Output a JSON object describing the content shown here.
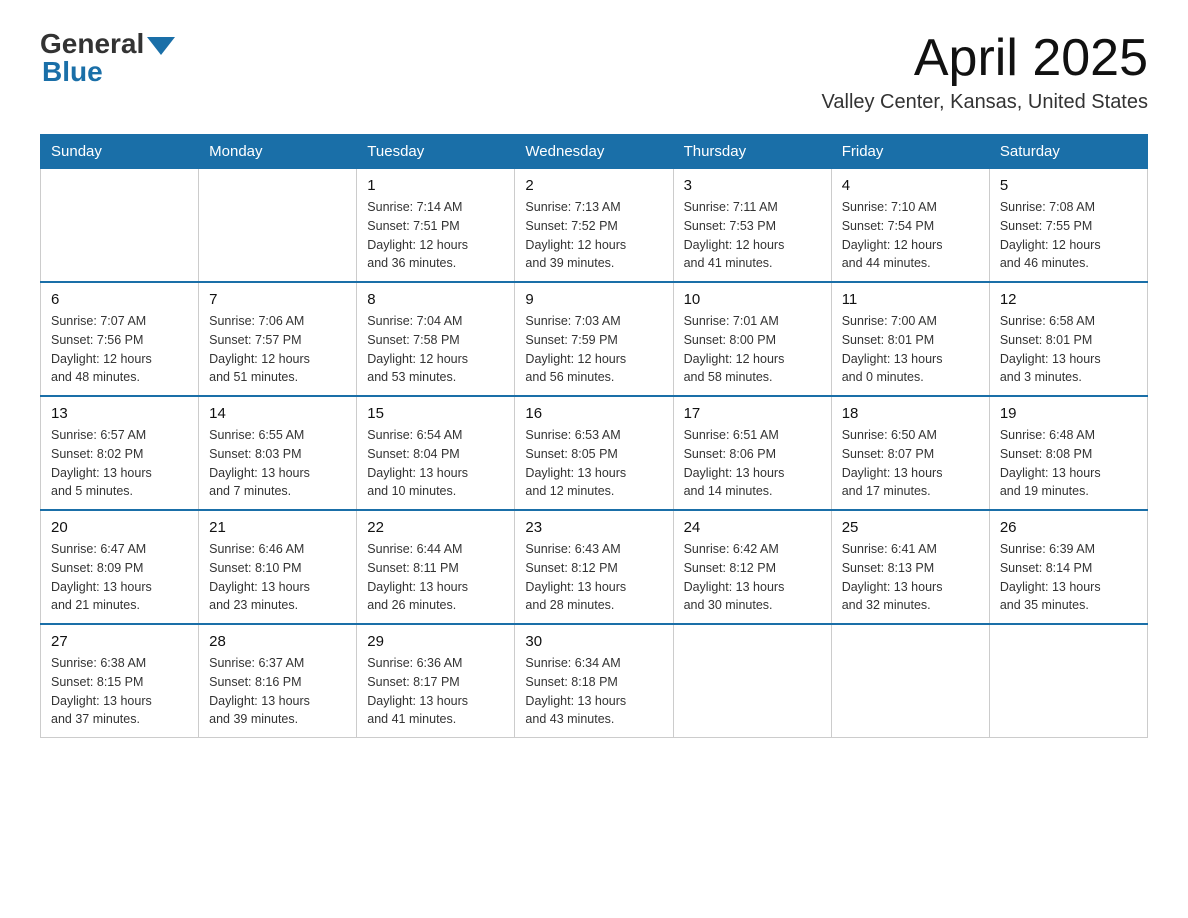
{
  "header": {
    "logo_general": "General",
    "logo_blue": "Blue",
    "title": "April 2025",
    "subtitle": "Valley Center, Kansas, United States"
  },
  "days_of_week": [
    "Sunday",
    "Monday",
    "Tuesday",
    "Wednesday",
    "Thursday",
    "Friday",
    "Saturday"
  ],
  "weeks": [
    [
      {
        "day": "",
        "info": ""
      },
      {
        "day": "",
        "info": ""
      },
      {
        "day": "1",
        "info": "Sunrise: 7:14 AM\nSunset: 7:51 PM\nDaylight: 12 hours\nand 36 minutes."
      },
      {
        "day": "2",
        "info": "Sunrise: 7:13 AM\nSunset: 7:52 PM\nDaylight: 12 hours\nand 39 minutes."
      },
      {
        "day": "3",
        "info": "Sunrise: 7:11 AM\nSunset: 7:53 PM\nDaylight: 12 hours\nand 41 minutes."
      },
      {
        "day": "4",
        "info": "Sunrise: 7:10 AM\nSunset: 7:54 PM\nDaylight: 12 hours\nand 44 minutes."
      },
      {
        "day": "5",
        "info": "Sunrise: 7:08 AM\nSunset: 7:55 PM\nDaylight: 12 hours\nand 46 minutes."
      }
    ],
    [
      {
        "day": "6",
        "info": "Sunrise: 7:07 AM\nSunset: 7:56 PM\nDaylight: 12 hours\nand 48 minutes."
      },
      {
        "day": "7",
        "info": "Sunrise: 7:06 AM\nSunset: 7:57 PM\nDaylight: 12 hours\nand 51 minutes."
      },
      {
        "day": "8",
        "info": "Sunrise: 7:04 AM\nSunset: 7:58 PM\nDaylight: 12 hours\nand 53 minutes."
      },
      {
        "day": "9",
        "info": "Sunrise: 7:03 AM\nSunset: 7:59 PM\nDaylight: 12 hours\nand 56 minutes."
      },
      {
        "day": "10",
        "info": "Sunrise: 7:01 AM\nSunset: 8:00 PM\nDaylight: 12 hours\nand 58 minutes."
      },
      {
        "day": "11",
        "info": "Sunrise: 7:00 AM\nSunset: 8:01 PM\nDaylight: 13 hours\nand 0 minutes."
      },
      {
        "day": "12",
        "info": "Sunrise: 6:58 AM\nSunset: 8:01 PM\nDaylight: 13 hours\nand 3 minutes."
      }
    ],
    [
      {
        "day": "13",
        "info": "Sunrise: 6:57 AM\nSunset: 8:02 PM\nDaylight: 13 hours\nand 5 minutes."
      },
      {
        "day": "14",
        "info": "Sunrise: 6:55 AM\nSunset: 8:03 PM\nDaylight: 13 hours\nand 7 minutes."
      },
      {
        "day": "15",
        "info": "Sunrise: 6:54 AM\nSunset: 8:04 PM\nDaylight: 13 hours\nand 10 minutes."
      },
      {
        "day": "16",
        "info": "Sunrise: 6:53 AM\nSunset: 8:05 PM\nDaylight: 13 hours\nand 12 minutes."
      },
      {
        "day": "17",
        "info": "Sunrise: 6:51 AM\nSunset: 8:06 PM\nDaylight: 13 hours\nand 14 minutes."
      },
      {
        "day": "18",
        "info": "Sunrise: 6:50 AM\nSunset: 8:07 PM\nDaylight: 13 hours\nand 17 minutes."
      },
      {
        "day": "19",
        "info": "Sunrise: 6:48 AM\nSunset: 8:08 PM\nDaylight: 13 hours\nand 19 minutes."
      }
    ],
    [
      {
        "day": "20",
        "info": "Sunrise: 6:47 AM\nSunset: 8:09 PM\nDaylight: 13 hours\nand 21 minutes."
      },
      {
        "day": "21",
        "info": "Sunrise: 6:46 AM\nSunset: 8:10 PM\nDaylight: 13 hours\nand 23 minutes."
      },
      {
        "day": "22",
        "info": "Sunrise: 6:44 AM\nSunset: 8:11 PM\nDaylight: 13 hours\nand 26 minutes."
      },
      {
        "day": "23",
        "info": "Sunrise: 6:43 AM\nSunset: 8:12 PM\nDaylight: 13 hours\nand 28 minutes."
      },
      {
        "day": "24",
        "info": "Sunrise: 6:42 AM\nSunset: 8:12 PM\nDaylight: 13 hours\nand 30 minutes."
      },
      {
        "day": "25",
        "info": "Sunrise: 6:41 AM\nSunset: 8:13 PM\nDaylight: 13 hours\nand 32 minutes."
      },
      {
        "day": "26",
        "info": "Sunrise: 6:39 AM\nSunset: 8:14 PM\nDaylight: 13 hours\nand 35 minutes."
      }
    ],
    [
      {
        "day": "27",
        "info": "Sunrise: 6:38 AM\nSunset: 8:15 PM\nDaylight: 13 hours\nand 37 minutes."
      },
      {
        "day": "28",
        "info": "Sunrise: 6:37 AM\nSunset: 8:16 PM\nDaylight: 13 hours\nand 39 minutes."
      },
      {
        "day": "29",
        "info": "Sunrise: 6:36 AM\nSunset: 8:17 PM\nDaylight: 13 hours\nand 41 minutes."
      },
      {
        "day": "30",
        "info": "Sunrise: 6:34 AM\nSunset: 8:18 PM\nDaylight: 13 hours\nand 43 minutes."
      },
      {
        "day": "",
        "info": ""
      },
      {
        "day": "",
        "info": ""
      },
      {
        "day": "",
        "info": ""
      }
    ]
  ]
}
